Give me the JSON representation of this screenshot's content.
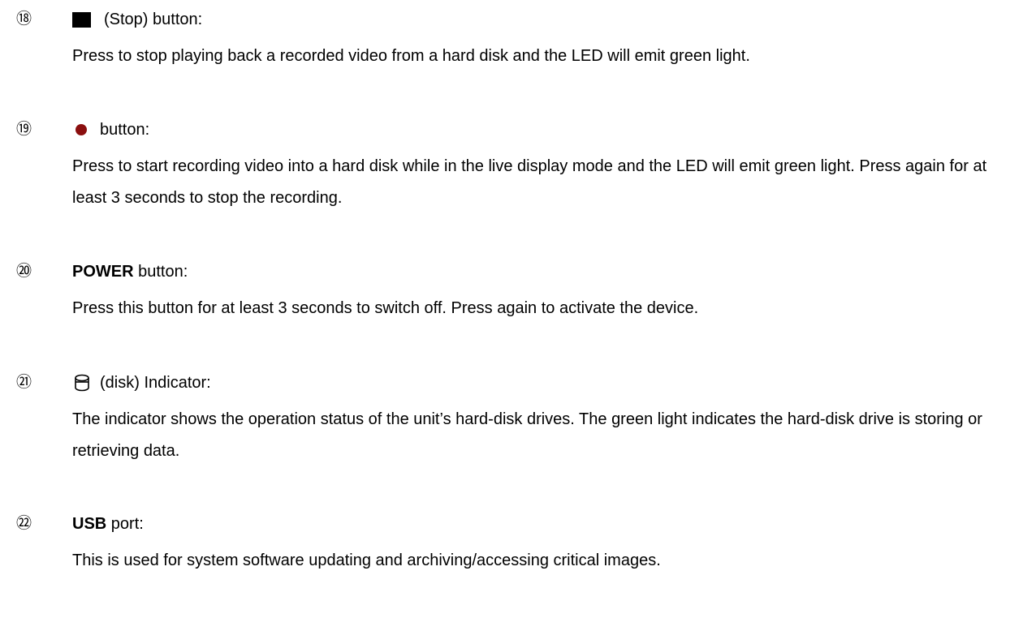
{
  "items": [
    {
      "number": "⑱",
      "icon": "stop-square-icon",
      "label_pre": "",
      "label_bold": "",
      "label_rest": "(Stop) button:",
      "description": "Press to stop playing back a recorded video from a hard disk and the LED will emit green light."
    },
    {
      "number": "⑲",
      "icon": "record-dot-icon",
      "label_bold": "",
      "label_rest": "button:",
      "description": "Press to start recording video into a hard disk while in the live display mode and the LED will emit green light. Press again for at least 3 seconds to stop the recording."
    },
    {
      "number": "⑳",
      "icon": "",
      "label_bold": "POWER",
      "label_rest": " button:",
      "description": "Press this button for at least 3 seconds to switch off. Press again to activate the device."
    },
    {
      "number": "㉑",
      "icon": "disk-icon",
      "label_bold": "",
      "label_rest": "(disk) Indicator:",
      "description": "The indicator shows the operation status of the unit’s hard-disk drives. The green light indicates the hard-disk drive is storing or retrieving data."
    },
    {
      "number": "㉒",
      "icon": "",
      "label_bold": "USB",
      "label_rest": " port:",
      "description": "This is used for system software updating and archiving/accessing critical images."
    }
  ],
  "colors": {
    "text": "#000000",
    "record_icon": "#8b0f0f",
    "background": "#ffffff"
  }
}
